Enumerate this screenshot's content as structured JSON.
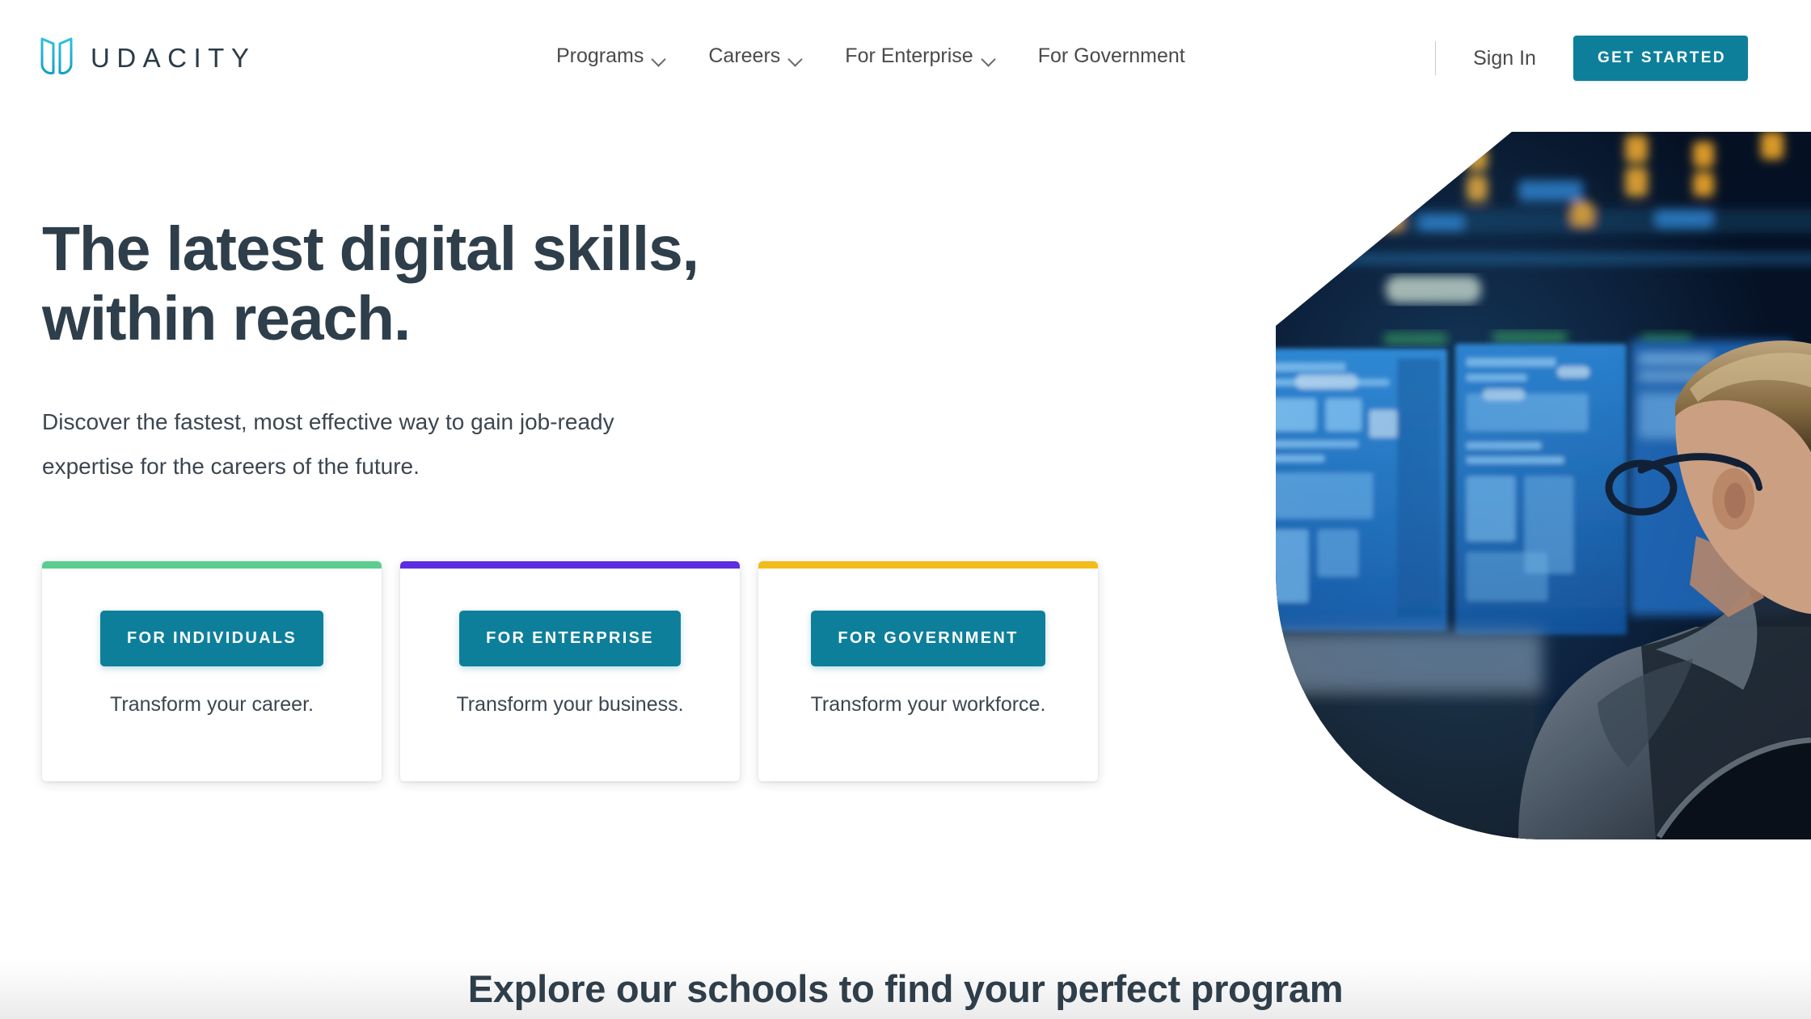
{
  "brand": {
    "name": "UDACITY",
    "logo_icon": "udacity-u-logo",
    "logo_color_start": "#2ab7d6",
    "logo_color_end": "#1fa8cc"
  },
  "header": {
    "nav": [
      {
        "label": "Programs",
        "has_dropdown": true
      },
      {
        "label": "Careers",
        "has_dropdown": true
      },
      {
        "label": "For Enterprise",
        "has_dropdown": true
      },
      {
        "label": "For Government",
        "has_dropdown": false
      }
    ],
    "sign_in_label": "Sign In",
    "cta_label": "GET STARTED",
    "cta_color": "#0e7f9b"
  },
  "hero": {
    "headline_line1": "The latest digital skills,",
    "headline_line2": "within reach.",
    "headline_color": "#2e3e4a",
    "subhead_line1": "Discover the fastest, most effective way to gain job-ready",
    "subhead_line2": "expertise for the careers of the future.",
    "image_alt": "man-with-glasses-viewing-blue-monitoring-screens-in-dark-control-room"
  },
  "cards": [
    {
      "accent_color": "#5bce8f",
      "button_label": "FOR INDIVIDUALS",
      "caption": "Transform your career."
    },
    {
      "accent_color": "#5b2ee0",
      "button_label": "FOR ENTERPRISE",
      "caption": "Transform your business."
    },
    {
      "accent_color": "#f2bc1b",
      "button_label": "FOR GOVERNMENT",
      "caption": "Transform your workforce."
    }
  ],
  "section": {
    "title": "Explore our schools to find your perfect program"
  }
}
